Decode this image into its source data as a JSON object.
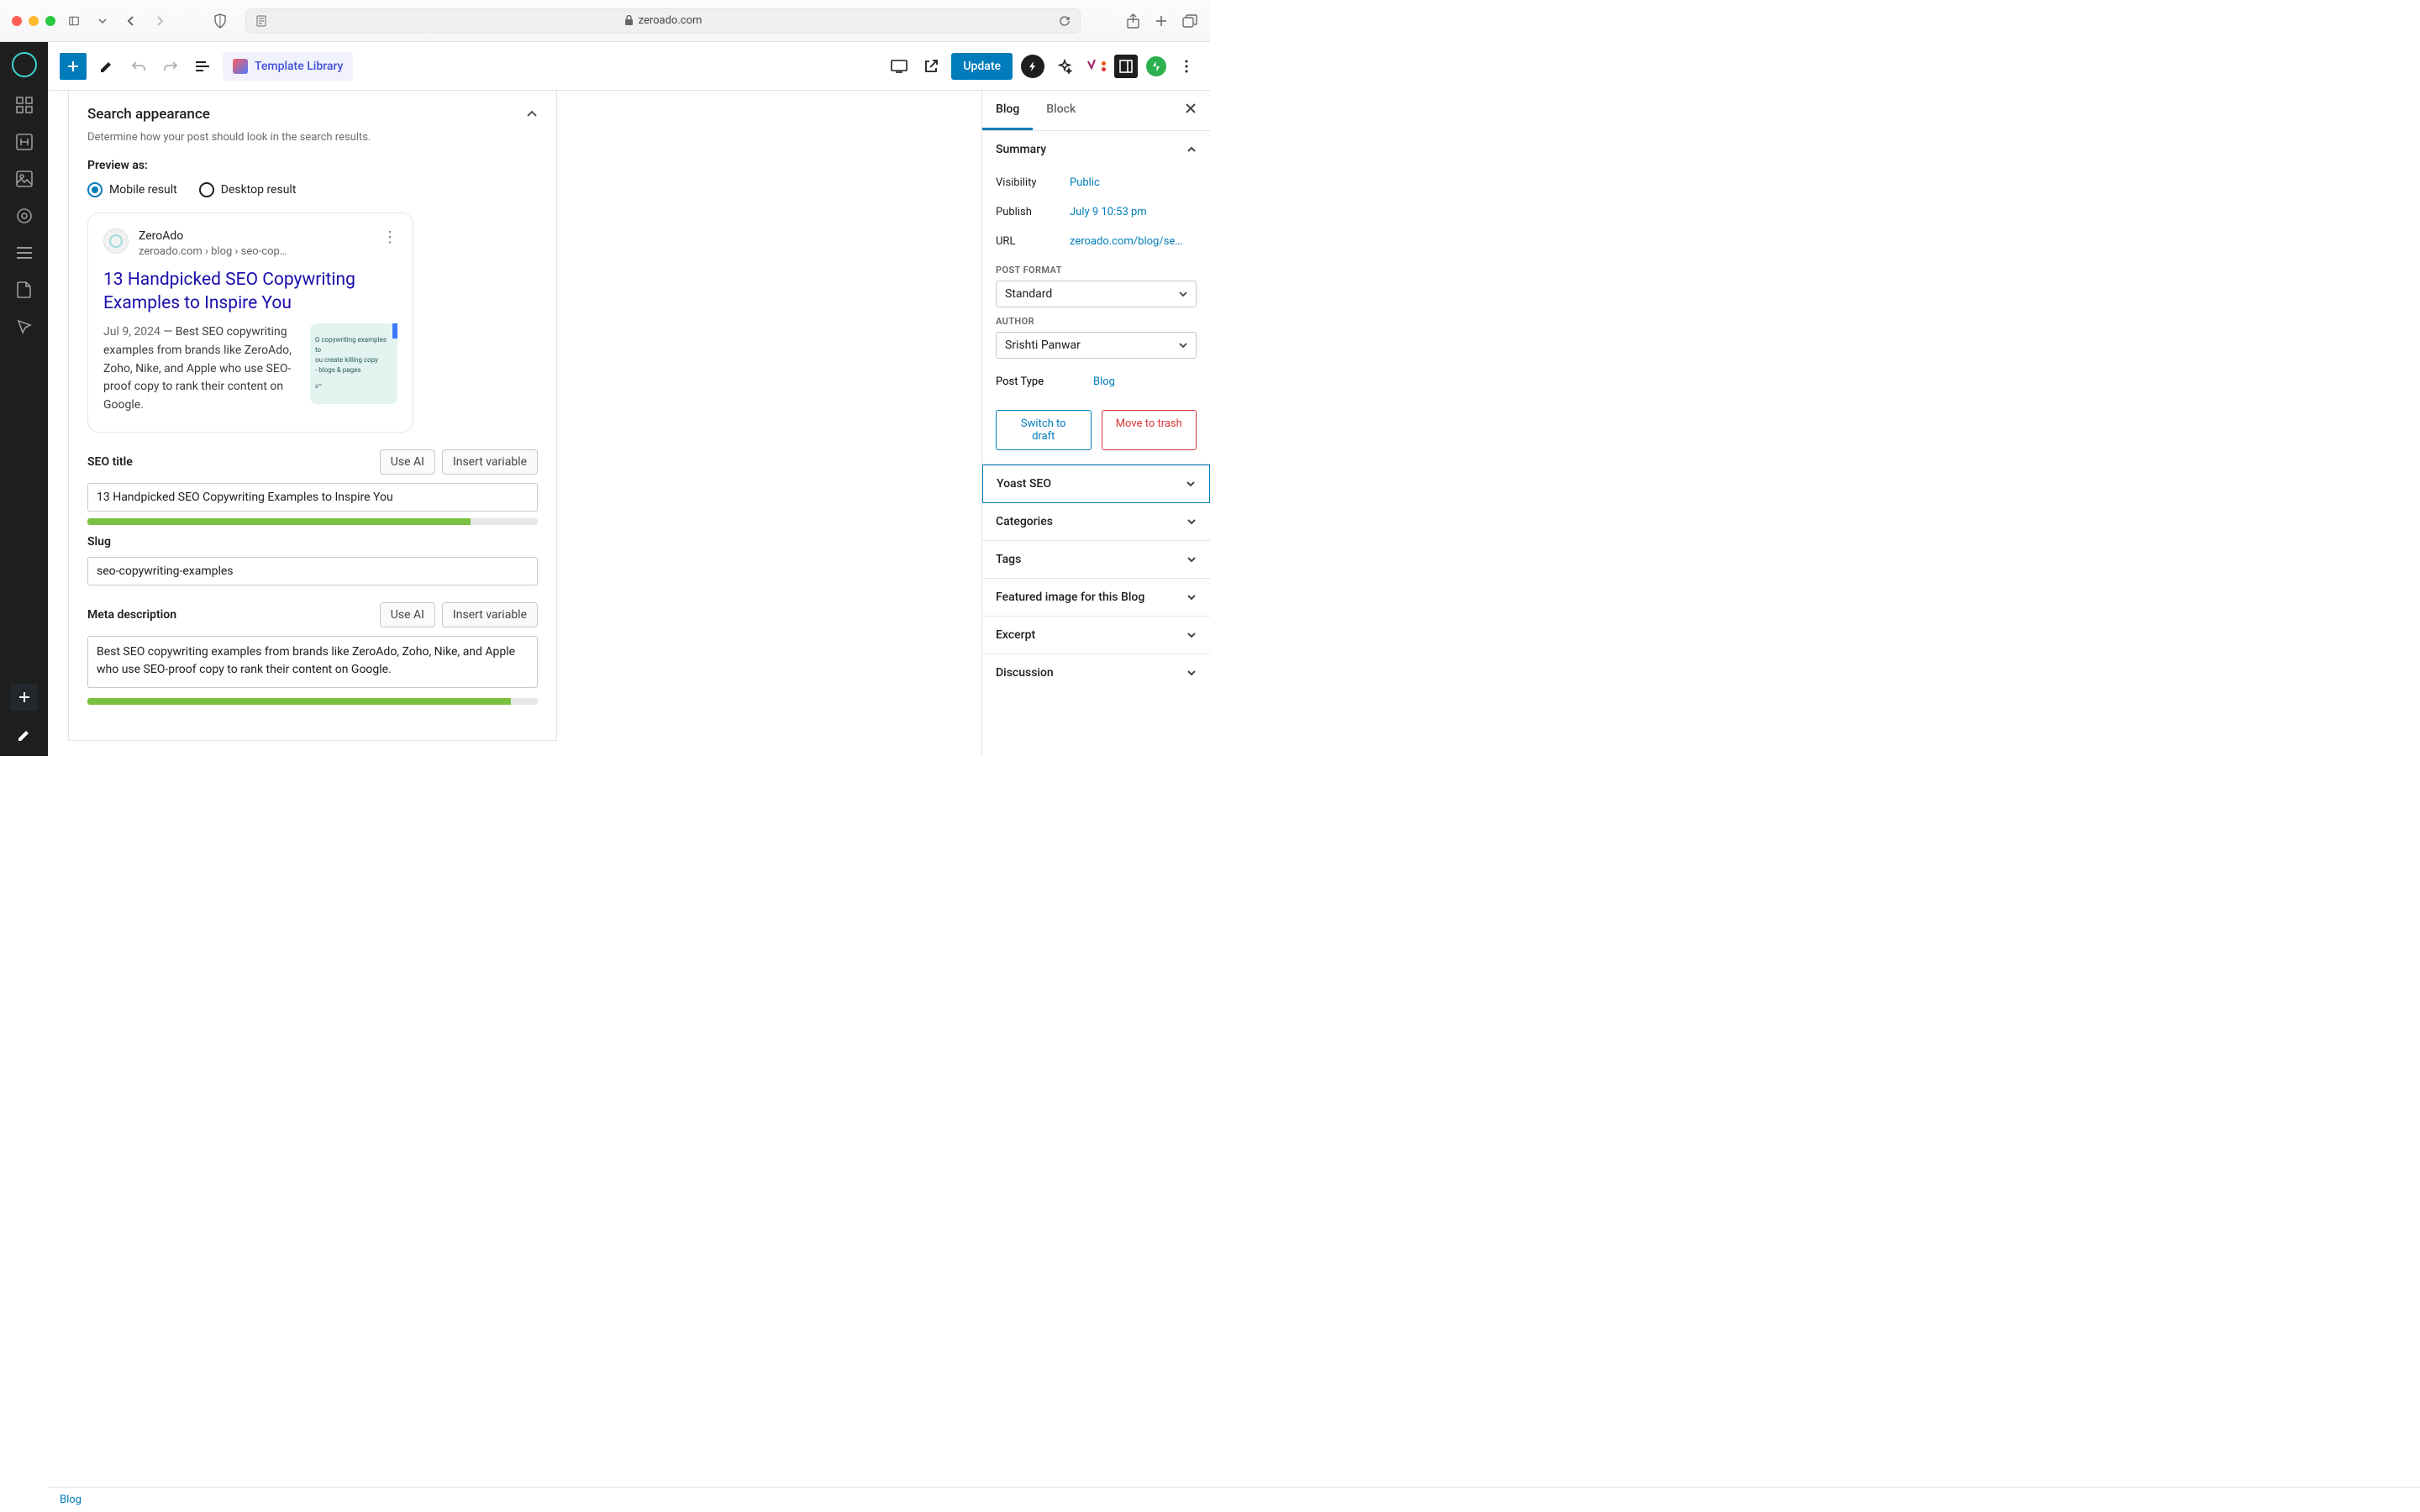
{
  "browser": {
    "domain": "zeroado.com"
  },
  "toolbar": {
    "template_library": "Template Library",
    "update": "Update"
  },
  "yoast_panel": {
    "title": "Search appearance",
    "subtitle": "Determine how your post should look in the search results.",
    "preview_as": "Preview as:",
    "radio_mobile": "Mobile result",
    "radio_desktop": "Desktop result",
    "serp": {
      "site": "ZeroAdo",
      "breadcrumb": "zeroado.com › blog › seo-cop…",
      "title": "13 Handpicked SEO Copywriting Examples to Inspire You",
      "date": "Jul 9, 2024",
      "desc": "Best SEO copywriting examples from brands like ZeroAdo, Zoho, Nike, and Apple who use SEO-proof copy to rank their content on Google.",
      "thumb_line1": "O copywriting examples to",
      "thumb_line2": "ou create killing copy",
      "thumb_line3": "- blogs & pages"
    },
    "seo_title_label": "SEO title",
    "seo_title_value": "13 Handpicked SEO Copywriting Examples to Inspire You",
    "slug_label": "Slug",
    "slug_value": "seo-copywriting-examples",
    "meta_label": "Meta description",
    "meta_value": "Best SEO copywriting examples from brands like ZeroAdo, Zoho, Nike, and Apple who use SEO-proof copy to rank their content on Google.",
    "use_ai": "Use AI",
    "insert_variable": "Insert variable"
  },
  "sidebar": {
    "tabs": {
      "blog": "Blog",
      "block": "Block"
    },
    "summary": {
      "title": "Summary",
      "visibility_label": "Visibility",
      "visibility_value": "Public",
      "publish_label": "Publish",
      "publish_value": "July 9 10:53 pm",
      "url_label": "URL",
      "url_value": "zeroado.com/blog/se…",
      "post_format_label": "POST FORMAT",
      "post_format_value": "Standard",
      "author_label": "AUTHOR",
      "author_value": "Srishti Panwar",
      "post_type_label": "Post Type",
      "post_type_value": "Blog",
      "switch_draft": "Switch to draft",
      "move_trash": "Move to trash"
    },
    "sections": {
      "yoast": "Yoast SEO",
      "categories": "Categories",
      "tags": "Tags",
      "featured": "Featured image for this Blog",
      "excerpt": "Excerpt",
      "discussion": "Discussion"
    }
  },
  "footer": {
    "breadcrumb": "Blog"
  }
}
